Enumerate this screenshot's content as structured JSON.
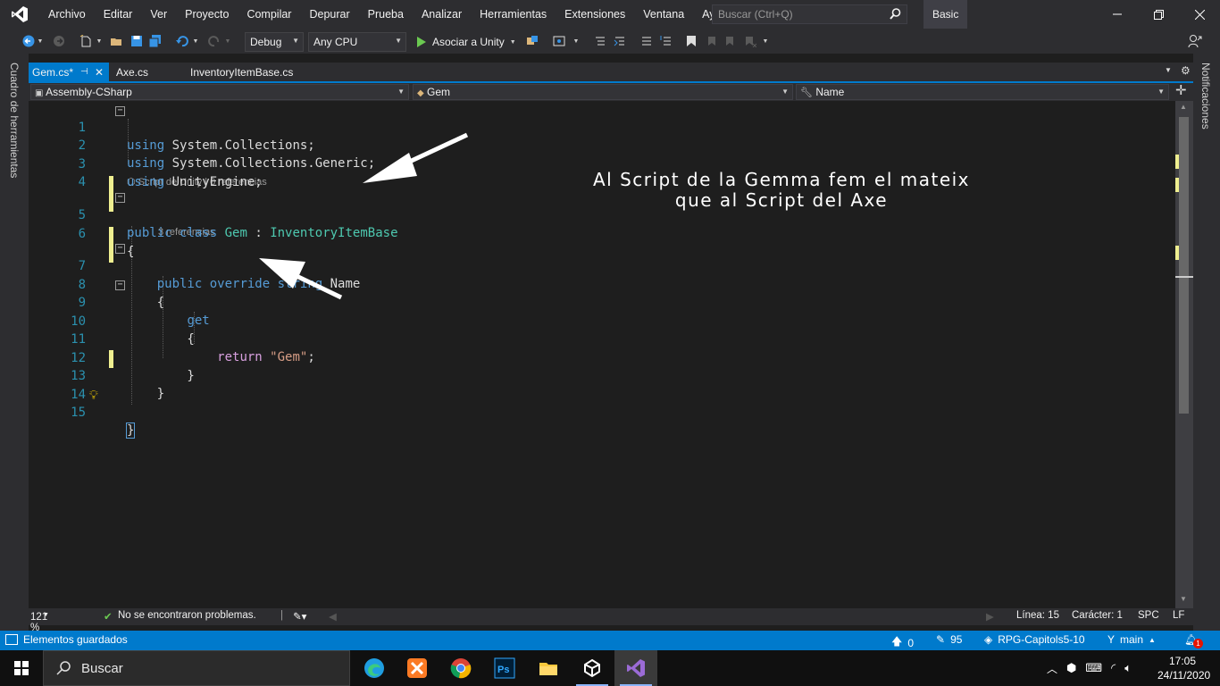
{
  "menubar": {
    "items": [
      "Archivo",
      "Editar",
      "Ver",
      "Proyecto",
      "Compilar",
      "Depurar",
      "Prueba",
      "Analizar",
      "Herramientas",
      "Extensiones",
      "Ventana",
      "Ayuda"
    ],
    "search_placeholder": "Buscar (Ctrl+Q)",
    "profile": "Basic"
  },
  "toolbar": {
    "config": "Debug",
    "platform": "Any CPU",
    "run_label": "Asociar a Unity"
  },
  "side_panels": {
    "left": "Cuadro de herramientas",
    "right": "Notificaciones"
  },
  "tabs": [
    {
      "label": "Gem.cs*",
      "active": true
    },
    {
      "label": "Axe.cs",
      "active": false
    },
    {
      "label": "InventoryItemBase.cs",
      "active": false
    }
  ],
  "navbar": {
    "project": "Assembly-CSharp",
    "type": "Gem",
    "member": "Name"
  },
  "codelens": {
    "class": "Script de Unity | 0 referencias",
    "property": "3 referencias"
  },
  "code_lines": [
    {
      "n": "1",
      "text": "using System.Collections;"
    },
    {
      "n": "2",
      "text": "using System.Collections.Generic;"
    },
    {
      "n": "3",
      "text": "using UnityEngine;"
    },
    {
      "n": "4",
      "text": ""
    },
    {
      "n": "5",
      "text": "public class Gem : InventoryItemBase"
    },
    {
      "n": "6",
      "text": "{"
    },
    {
      "n": "7",
      "text": "    public override string Name"
    },
    {
      "n": "8",
      "text": "    {"
    },
    {
      "n": "9",
      "text": "        get"
    },
    {
      "n": "10",
      "text": "        {"
    },
    {
      "n": "11",
      "text": "            return \"Gem\";"
    },
    {
      "n": "12",
      "text": "        }"
    },
    {
      "n": "13",
      "text": "    }"
    },
    {
      "n": "14",
      "text": ""
    },
    {
      "n": "15",
      "text": "}"
    }
  ],
  "annotation": {
    "line1": "Al Script de la Gemma fem el mateix",
    "line2": "que al Script del Axe"
  },
  "editor_status": {
    "zoom": "121 %",
    "problems": "No se encontraron problemas.",
    "line": "Línea: 15",
    "char": "Carácter: 1",
    "spaces": "SPC",
    "eol": "LF"
  },
  "statusbar": {
    "message": "Elementos guardados",
    "up_count": "0",
    "edit_count": "95",
    "repo": "RPG-Capitols5-10",
    "branch": "main",
    "notification_count": "1"
  },
  "taskbar": {
    "search_placeholder": "Buscar",
    "time": "17:05",
    "date": "24/11/2020"
  },
  "colors": {
    "accent": "#007acc",
    "keyword": "#569cd6",
    "type": "#4ec9b0",
    "string": "#d69d85",
    "control": "#d8a0df"
  }
}
